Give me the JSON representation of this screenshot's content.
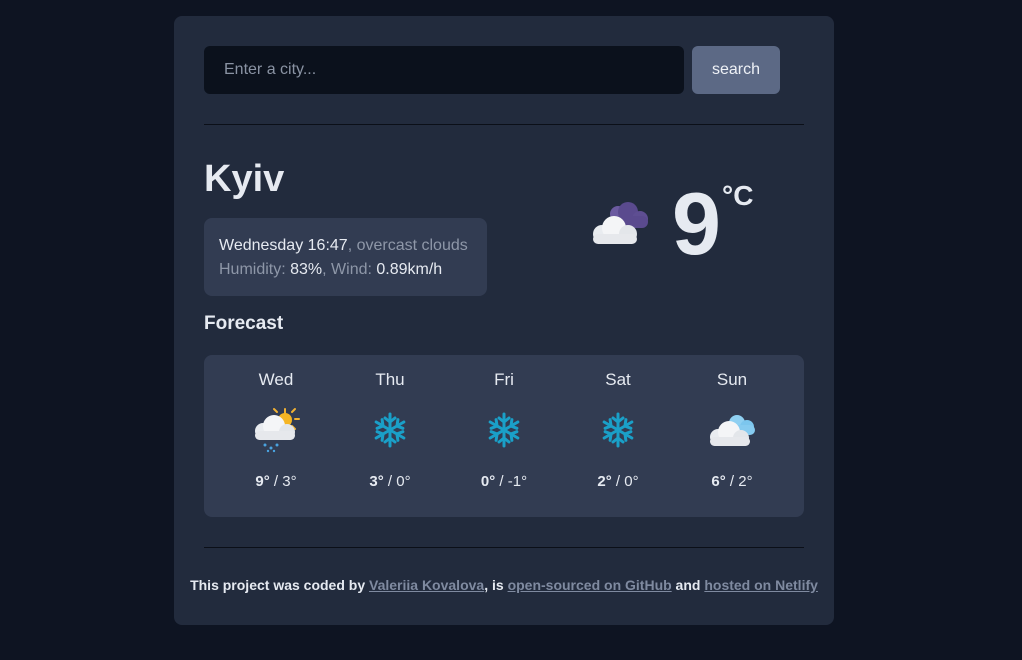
{
  "search": {
    "placeholder": "Enter a city...",
    "value": "",
    "button_label": "search"
  },
  "current": {
    "city": "Kyiv",
    "datetime": "Wednesday 16:47",
    "description": ", overcast clouds",
    "humidity_label": "Humidity: ",
    "humidity_value": "83%",
    "wind_label": ", Wind: ",
    "wind_value": "0.89km/h",
    "temperature": "9",
    "unit": "°C",
    "icon": "overcast-clouds-icon"
  },
  "forecast": {
    "title": "Forecast",
    "days": [
      {
        "day": "Wed",
        "max": "9°",
        "min": " / 3°",
        "icon": "rain-sun-cloud-icon"
      },
      {
        "day": "Thu",
        "max": "3°",
        "min": " / 0°",
        "icon": "snowflake-icon"
      },
      {
        "day": "Fri",
        "max": "0°",
        "min": " / -1°",
        "icon": "snowflake-icon"
      },
      {
        "day": "Sat",
        "max": "2°",
        "min": " / 0°",
        "icon": "snowflake-icon"
      },
      {
        "day": "Sun",
        "max": "6°",
        "min": " / 2°",
        "icon": "clouds-icon"
      }
    ]
  },
  "footer": {
    "text1": "This project was coded by ",
    "author": "Valeriia Kovalova",
    "text2": ", is ",
    "github": "open-sourced on GitHub",
    "text3": " and ",
    "netlify": "hosted on Netlify"
  },
  "colors": {
    "background": "#0e1422",
    "card": "#222b3d",
    "panel": "#323c52",
    "button": "#5c6985",
    "snowflake": "#1aa0c8"
  }
}
